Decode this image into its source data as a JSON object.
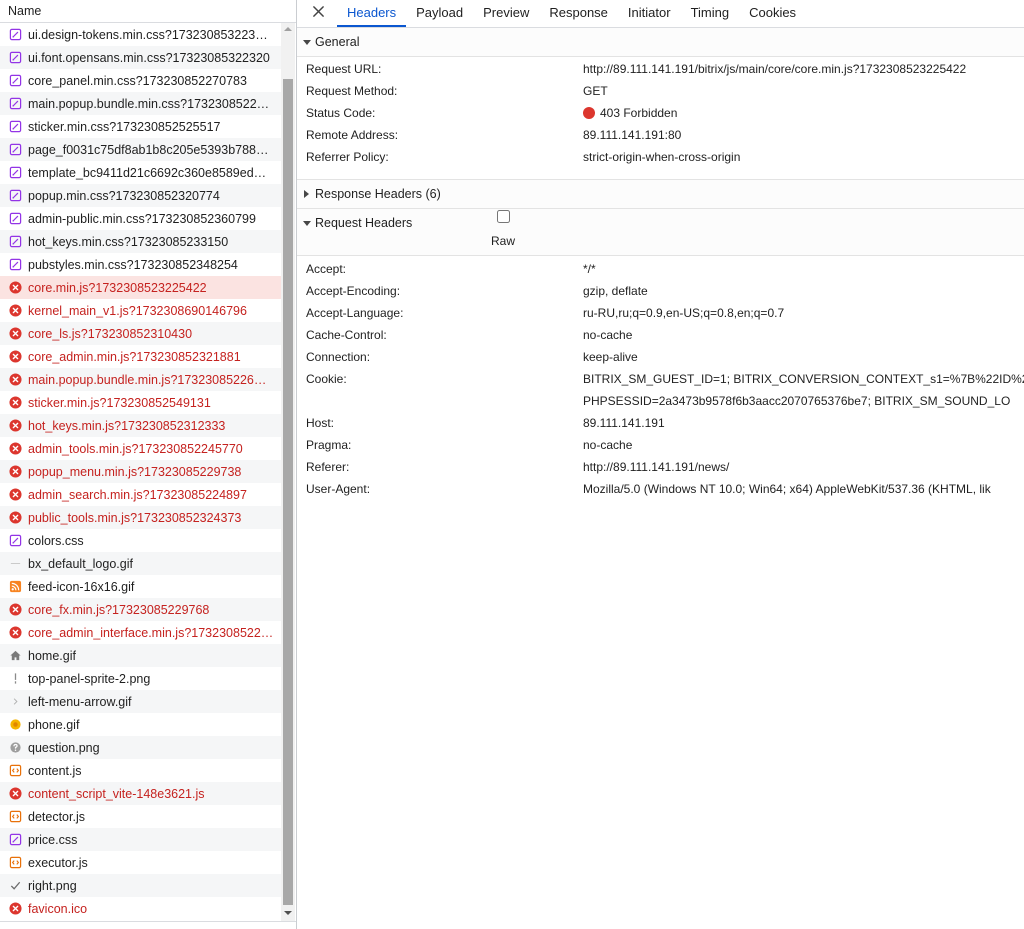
{
  "colors": {
    "accent": "#0b57d0",
    "error_text": "#c5221f",
    "error_icon": "#dc362e",
    "selected_row_bg": "#fbe3e1",
    "css_icon": "#9334e6",
    "js_icon": "#e8710a"
  },
  "request_list": {
    "column_header": "Name",
    "rows": [
      {
        "name": "ui.design-tokens.min.css?173230853223…",
        "icon": "css-file-icon",
        "error": false
      },
      {
        "name": "ui.font.opensans.min.css?17323085322320",
        "icon": "css-file-icon",
        "error": false
      },
      {
        "name": "core_panel.min.css?173230852270783",
        "icon": "css-file-icon",
        "error": false
      },
      {
        "name": "main.popup.bundle.min.css?1732308522…",
        "icon": "css-file-icon",
        "error": false
      },
      {
        "name": "sticker.min.css?173230852525517",
        "icon": "css-file-icon",
        "error": false
      },
      {
        "name": "page_f0031c75df8ab1b8c205e5393b788…",
        "icon": "css-file-icon",
        "error": false
      },
      {
        "name": "template_bc9411d21c6692c360e8589ed…",
        "icon": "css-file-icon",
        "error": false
      },
      {
        "name": "popup.min.css?173230852320774",
        "icon": "css-file-icon",
        "error": false
      },
      {
        "name": "admin-public.min.css?173230852360799",
        "icon": "css-file-icon",
        "error": false
      },
      {
        "name": "hot_keys.min.css?17323085233150",
        "icon": "css-file-icon",
        "error": false
      },
      {
        "name": "pubstyles.min.css?173230852348254",
        "icon": "css-file-icon",
        "error": false
      },
      {
        "name": "core.min.js?1732308523225422",
        "icon": "error-icon",
        "error": true,
        "selected": true
      },
      {
        "name": "kernel_main_v1.js?1732308690146796",
        "icon": "error-icon",
        "error": true
      },
      {
        "name": "core_ls.js?173230852310430",
        "icon": "error-icon",
        "error": true
      },
      {
        "name": "core_admin.min.js?173230852321881",
        "icon": "error-icon",
        "error": true
      },
      {
        "name": "main.popup.bundle.min.js?17323085226…",
        "icon": "error-icon",
        "error": true
      },
      {
        "name": "sticker.min.js?173230852549131",
        "icon": "error-icon",
        "error": true
      },
      {
        "name": "hot_keys.min.js?173230852312333",
        "icon": "error-icon",
        "error": true
      },
      {
        "name": "admin_tools.min.js?173230852245770",
        "icon": "error-icon",
        "error": true
      },
      {
        "name": "popup_menu.min.js?17323085229738",
        "icon": "error-icon",
        "error": true
      },
      {
        "name": "admin_search.min.js?17323085224897",
        "icon": "error-icon",
        "error": true
      },
      {
        "name": "public_tools.min.js?173230852324373",
        "icon": "error-icon",
        "error": true
      },
      {
        "name": "colors.css",
        "icon": "css-file-icon",
        "error": false
      },
      {
        "name": "bx_default_logo.gif",
        "icon": "dash-image-icon",
        "error": false
      },
      {
        "name": "feed-icon-16x16.gif",
        "icon": "rss-feed-icon",
        "error": false
      },
      {
        "name": "core_fx.min.js?17323085229768",
        "icon": "error-icon",
        "error": true
      },
      {
        "name": "core_admin_interface.min.js?1732308522…",
        "icon": "error-icon",
        "error": true
      },
      {
        "name": "home.gif",
        "icon": "home-icon",
        "error": false
      },
      {
        "name": "top-panel-sprite-2.png",
        "icon": "exclamation-icon",
        "error": false
      },
      {
        "name": "left-menu-arrow.gif",
        "icon": "chevron-right-icon",
        "error": false
      },
      {
        "name": "phone.gif",
        "icon": "phone-icon",
        "error": false
      },
      {
        "name": "question.png",
        "icon": "question-icon",
        "error": false
      },
      {
        "name": "content.js",
        "icon": "js-file-icon",
        "error": false
      },
      {
        "name": "content_script_vite-148e3621.js",
        "icon": "error-icon",
        "error": true
      },
      {
        "name": "detector.js",
        "icon": "js-file-icon",
        "error": false
      },
      {
        "name": "price.css",
        "icon": "css-file-icon",
        "error": false
      },
      {
        "name": "executor.js",
        "icon": "js-file-icon",
        "error": false
      },
      {
        "name": "right.png",
        "icon": "checkmark-icon",
        "error": false
      },
      {
        "name": "favicon.ico",
        "icon": "error-icon",
        "error": true
      }
    ]
  },
  "details": {
    "close_icon": "close-icon",
    "tabs": [
      {
        "label": "Headers",
        "selected": true
      },
      {
        "label": "Payload",
        "selected": false
      },
      {
        "label": "Preview",
        "selected": false
      },
      {
        "label": "Response",
        "selected": false
      },
      {
        "label": "Initiator",
        "selected": false
      },
      {
        "label": "Timing",
        "selected": false
      },
      {
        "label": "Cookies",
        "selected": false
      }
    ],
    "general": {
      "title": "General",
      "expanded": true,
      "rows": [
        {
          "key": "Request URL:",
          "value": "http://89.111.141.191/bitrix/js/main/core/core.min.js?1732308523225422"
        },
        {
          "key": "Request Method:",
          "value": "GET"
        },
        {
          "key": "Status Code:",
          "value": "403 Forbidden",
          "status_icon": "status-error-dot-icon"
        },
        {
          "key": "Remote Address:",
          "value": "89.111.141.191:80"
        },
        {
          "key": "Referrer Policy:",
          "value": "strict-origin-when-cross-origin"
        }
      ]
    },
    "response_headers": {
      "title": "Response Headers (6)",
      "expanded": false
    },
    "request_headers": {
      "title": "Request Headers",
      "expanded": true,
      "raw_label": "Raw",
      "raw_checked": false,
      "rows": [
        {
          "key": "Accept:",
          "value": "*/*"
        },
        {
          "key": "Accept-Encoding:",
          "value": "gzip, deflate"
        },
        {
          "key": "Accept-Language:",
          "value": "ru-RU,ru;q=0.9,en-US;q=0.8,en;q=0.7"
        },
        {
          "key": "Cache-Control:",
          "value": "no-cache"
        },
        {
          "key": "Connection:",
          "value": "keep-alive"
        },
        {
          "key": "Cookie:",
          "lines": [
            "BITRIX_SM_GUEST_ID=1; BITRIX_CONVERSION_CONTEXT_s1=%7B%22ID%2",
            "PHPSESSID=2a3473b9578f6b3aacc2070765376be7; BITRIX_SM_SOUND_LO"
          ]
        },
        {
          "key": "Host:",
          "value": "89.111.141.191"
        },
        {
          "key": "Pragma:",
          "value": "no-cache"
        },
        {
          "key": "Referer:",
          "value": "http://89.111.141.191/news/"
        },
        {
          "key": "User-Agent:",
          "value": "Mozilla/5.0 (Windows NT 10.0; Win64; x64) AppleWebKit/537.36 (KHTML, lik"
        }
      ]
    }
  }
}
